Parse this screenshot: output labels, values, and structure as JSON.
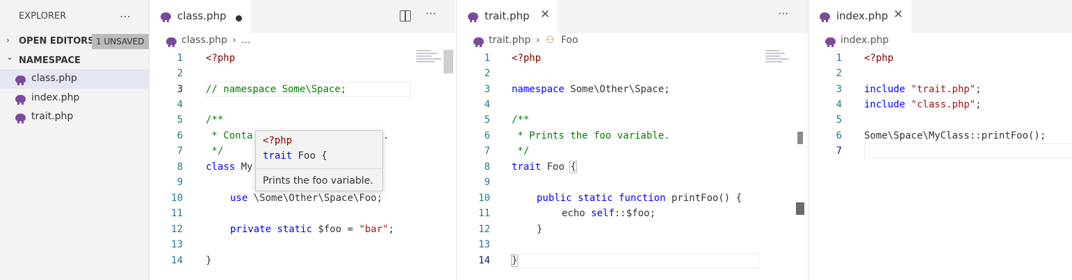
{
  "sidebar": {
    "title": "EXPLORER",
    "more_icon": "…",
    "open_editors": {
      "label": "OPEN EDITORS",
      "badge": "1 UNSAVED",
      "chevron": "›"
    },
    "namespace": {
      "label": "NAMESPACE",
      "chevron": "⌄"
    },
    "files": [
      {
        "name": "class.php"
      },
      {
        "name": "index.php"
      },
      {
        "name": "trait.php"
      }
    ]
  },
  "editor1": {
    "tab": {
      "label": "class.php",
      "dirty": true
    },
    "breadcrumb": {
      "file": "class.php",
      "sep": "›",
      "rest": "..."
    },
    "line_numbers": [
      "1",
      "2",
      "3",
      "4",
      "5",
      "6",
      "7",
      "8",
      "9",
      "10",
      "11",
      "12",
      "13",
      "14"
    ],
    "code": {
      "l1": "<?php",
      "l3": "// namespace Some\\Space;",
      "l5": "/**",
      "l6": " * Conta",
      "l6b": ".",
      "l7": " */",
      "l8_kw": "class",
      "l8_rest": " My",
      "l10_kw": "use",
      "l10_rest": " \\Some\\Other\\Space\\Foo;",
      "l12_kw": "private static",
      "l12_var": " $foo = ",
      "l12_str": "\"bar\"",
      "l12_end": ";",
      "l14": "}"
    },
    "hover": {
      "line1": "<?php",
      "line2_kw": "trait",
      "line2_rest": " Foo {",
      "doc": "Prints the foo variable."
    }
  },
  "editor2": {
    "tab": {
      "label": "trait.php",
      "close": "✕"
    },
    "breadcrumb": {
      "file": "trait.php",
      "sep": "›",
      "symbol_icon": "⚇",
      "symbol": "Foo"
    },
    "line_numbers": [
      "1",
      "2",
      "3",
      "4",
      "5",
      "6",
      "7",
      "8",
      "9",
      "10",
      "11",
      "12",
      "13",
      "14"
    ],
    "code": {
      "l1": "<?php",
      "l3_kw": "namespace",
      "l3_rest": " Some\\Other\\Space;",
      "l5": "/**",
      "l6": " * Prints the foo variable.",
      "l7": " */",
      "l8_kw": "trait",
      "l8_rest": " Foo ",
      "l8_brace": "{",
      "l10_kw": "public static function",
      "l10_rest": " printFoo() {",
      "l11_a": "echo ",
      "l11_kw": "self",
      "l11_rest": "::$foo;",
      "l12": "}",
      "l14": "}"
    }
  },
  "editor3": {
    "tab": {
      "label": "index.php",
      "close": "✕"
    },
    "breadcrumb": {
      "file": "index.php"
    },
    "line_numbers": [
      "1",
      "2",
      "3",
      "4",
      "5",
      "6",
      "7"
    ],
    "code": {
      "l1": "<?php",
      "l3_kw": "include",
      "l3_str": "\"trait.php\"",
      "l4_kw": "include",
      "l4_str": "\"class.php\"",
      "semi": ";",
      "l6": "Some\\Space\\MyClass::printFoo();"
    }
  },
  "actions": {
    "more": "···",
    "split_icon": "split-editor-icon"
  },
  "colors": {
    "keyword": "#0000ff",
    "comment": "#008000",
    "string": "#a31515",
    "php_tag": "#800000",
    "line_number": "#237893",
    "php_icon": "#7a4b9c"
  }
}
